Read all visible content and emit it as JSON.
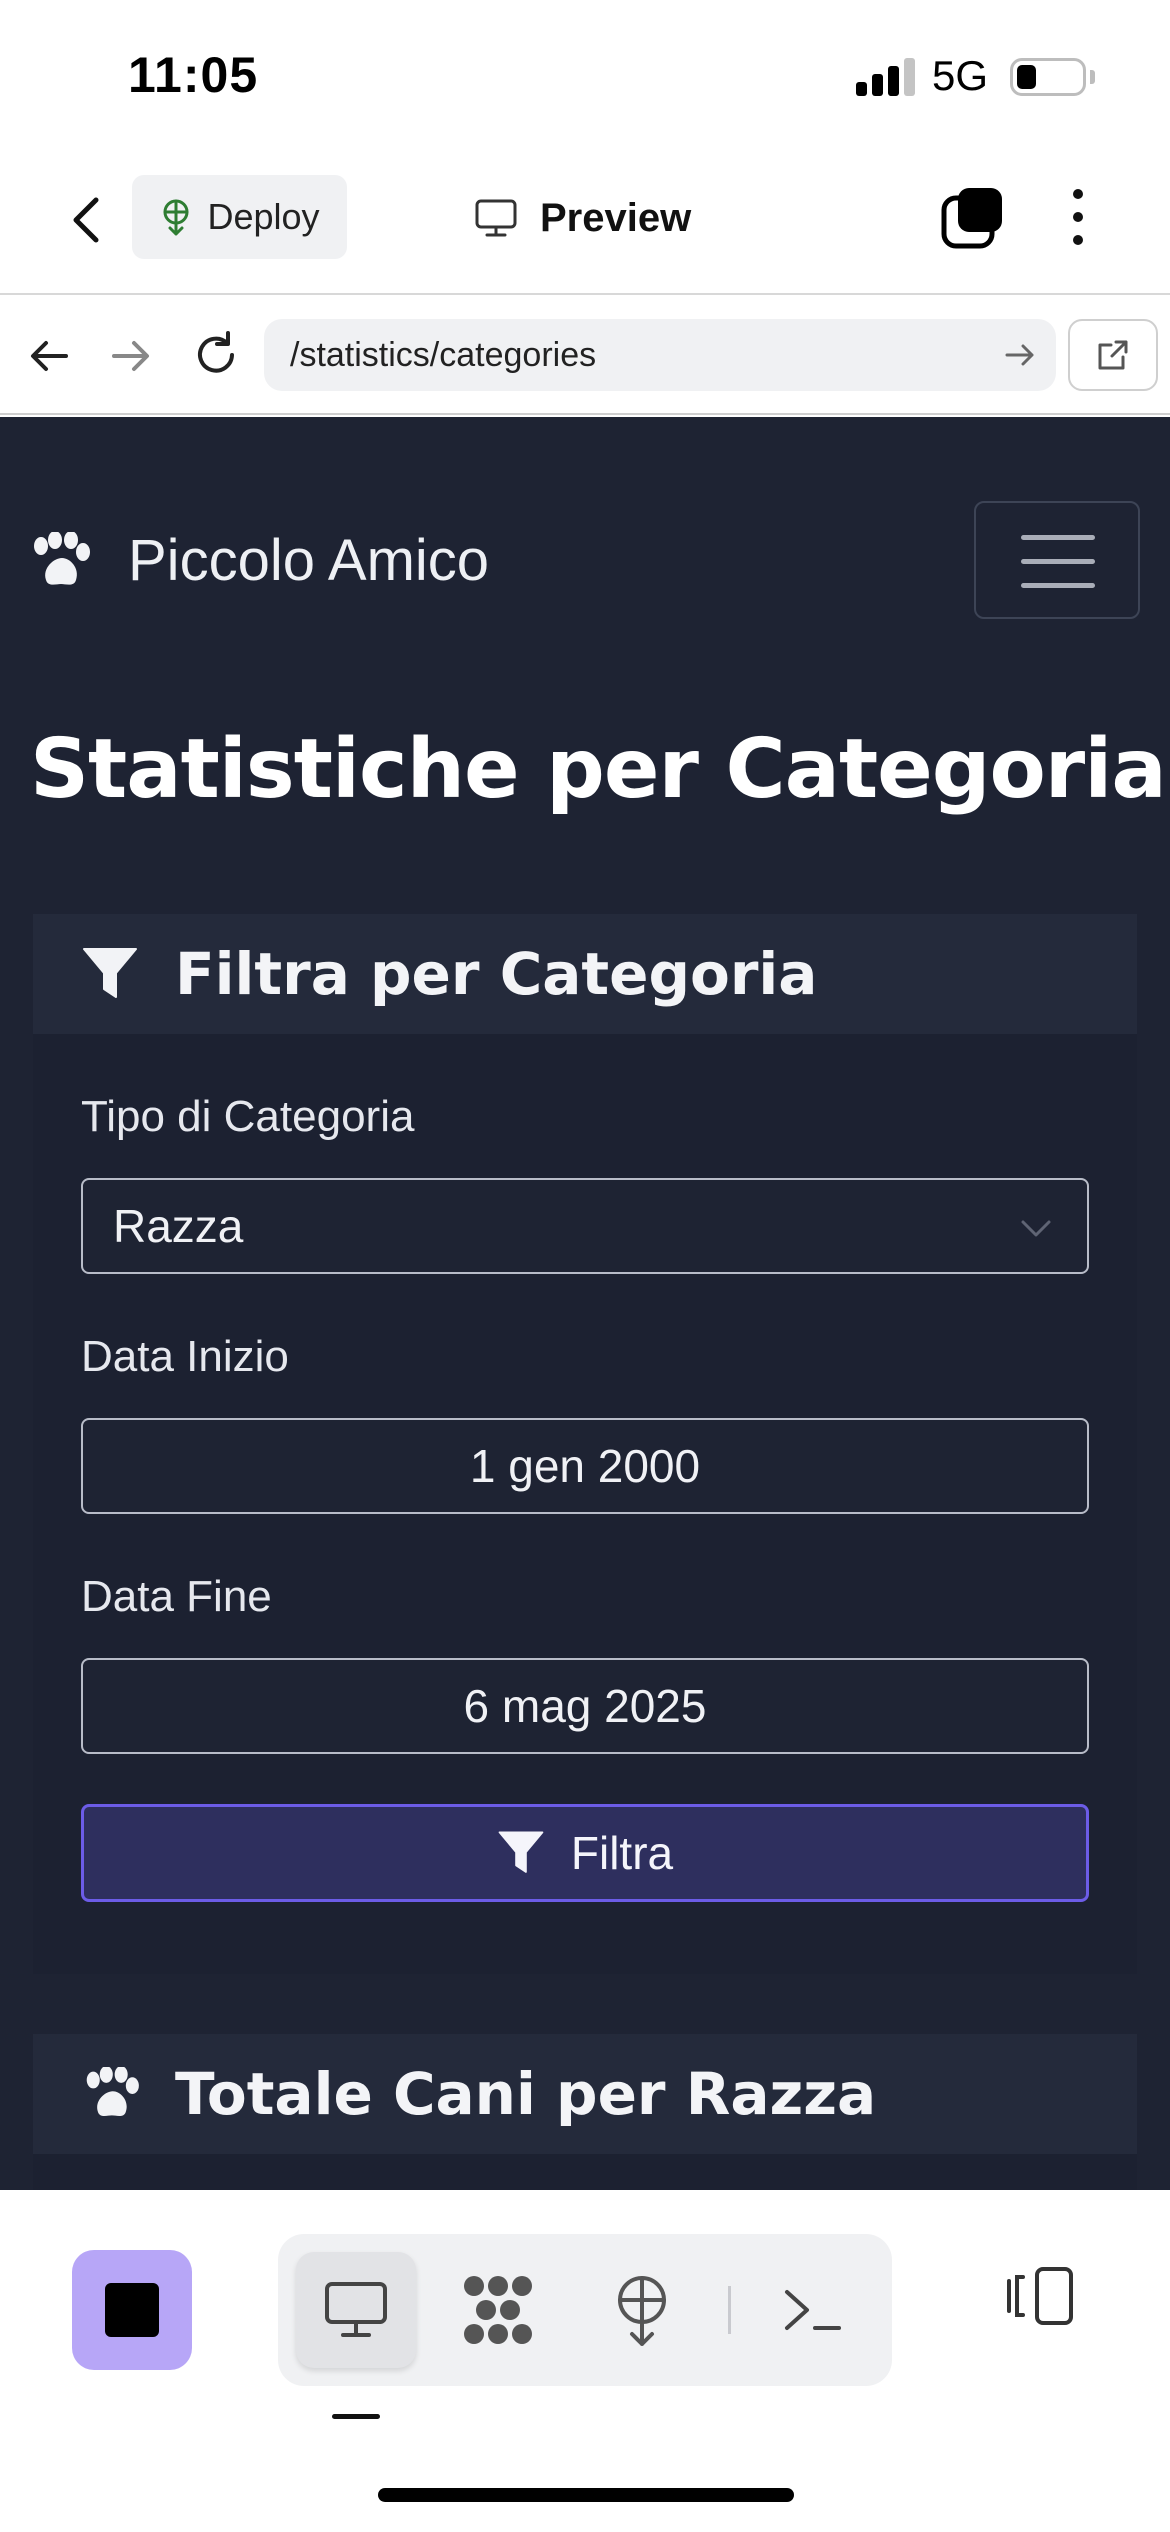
{
  "status_bar": {
    "time": "11:05",
    "network": "5G",
    "battery_level": 0.3,
    "signal_bars": 3
  },
  "toolbar": {
    "back_icon": "chevron-left-icon",
    "deploy_label": "Deploy",
    "preview_label": "Preview",
    "tabs_icon": "tabs-icon",
    "more_icon": "more-vertical-icon"
  },
  "browser": {
    "url": "/statistics/categories"
  },
  "site": {
    "brand": "Piccolo Amico",
    "page_title": "Statistiche per Categoria"
  },
  "filter_card": {
    "title": "Filtra per Categoria",
    "category_label": "Tipo di Categoria",
    "category_value": "Razza",
    "start_label": "Data Inizio",
    "start_value": "1 gen 2000",
    "end_label": "Data Fine",
    "end_value": "6 mag 2025",
    "submit_label": "Filtra"
  },
  "total_card": {
    "title": "Totale Cani per Razza"
  },
  "bottom_bar": {
    "active_view": "preview",
    "items": [
      "preview",
      "workflows",
      "deploy",
      "shell"
    ]
  },
  "colors": {
    "page_bg": "#1e2333",
    "card_header_bg": "#242a3b",
    "accent": "#6c5ce7",
    "stop_button": "#b7a6f7"
  }
}
